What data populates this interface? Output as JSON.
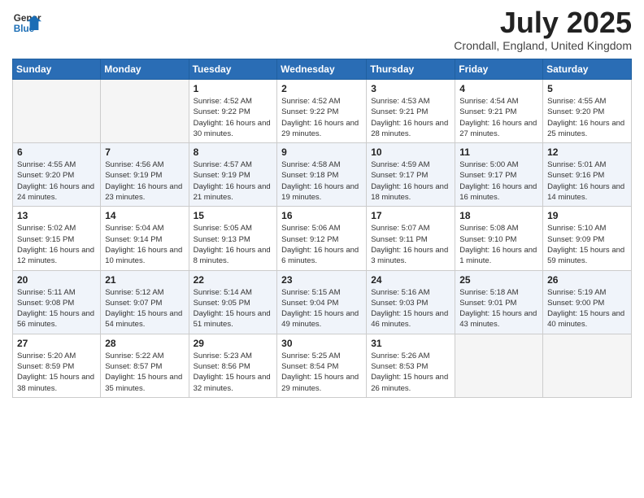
{
  "header": {
    "logo_general": "General",
    "logo_blue": "Blue",
    "month_title": "July 2025",
    "location": "Crondall, England, United Kingdom"
  },
  "weekdays": [
    "Sunday",
    "Monday",
    "Tuesday",
    "Wednesday",
    "Thursday",
    "Friday",
    "Saturday"
  ],
  "weeks": [
    [
      {
        "day": "",
        "empty": true
      },
      {
        "day": "",
        "empty": true
      },
      {
        "day": "1",
        "sunrise": "4:52 AM",
        "sunset": "9:22 PM",
        "daylight": "16 hours and 30 minutes."
      },
      {
        "day": "2",
        "sunrise": "4:52 AM",
        "sunset": "9:22 PM",
        "daylight": "16 hours and 29 minutes."
      },
      {
        "day": "3",
        "sunrise": "4:53 AM",
        "sunset": "9:21 PM",
        "daylight": "16 hours and 28 minutes."
      },
      {
        "day": "4",
        "sunrise": "4:54 AM",
        "sunset": "9:21 PM",
        "daylight": "16 hours and 27 minutes."
      },
      {
        "day": "5",
        "sunrise": "4:55 AM",
        "sunset": "9:20 PM",
        "daylight": "16 hours and 25 minutes."
      }
    ],
    [
      {
        "day": "6",
        "sunrise": "4:55 AM",
        "sunset": "9:20 PM",
        "daylight": "16 hours and 24 minutes."
      },
      {
        "day": "7",
        "sunrise": "4:56 AM",
        "sunset": "9:19 PM",
        "daylight": "16 hours and 23 minutes."
      },
      {
        "day": "8",
        "sunrise": "4:57 AM",
        "sunset": "9:19 PM",
        "daylight": "16 hours and 21 minutes."
      },
      {
        "day": "9",
        "sunrise": "4:58 AM",
        "sunset": "9:18 PM",
        "daylight": "16 hours and 19 minutes."
      },
      {
        "day": "10",
        "sunrise": "4:59 AM",
        "sunset": "9:17 PM",
        "daylight": "16 hours and 18 minutes."
      },
      {
        "day": "11",
        "sunrise": "5:00 AM",
        "sunset": "9:17 PM",
        "daylight": "16 hours and 16 minutes."
      },
      {
        "day": "12",
        "sunrise": "5:01 AM",
        "sunset": "9:16 PM",
        "daylight": "16 hours and 14 minutes."
      }
    ],
    [
      {
        "day": "13",
        "sunrise": "5:02 AM",
        "sunset": "9:15 PM",
        "daylight": "16 hours and 12 minutes."
      },
      {
        "day": "14",
        "sunrise": "5:04 AM",
        "sunset": "9:14 PM",
        "daylight": "16 hours and 10 minutes."
      },
      {
        "day": "15",
        "sunrise": "5:05 AM",
        "sunset": "9:13 PM",
        "daylight": "16 hours and 8 minutes."
      },
      {
        "day": "16",
        "sunrise": "5:06 AM",
        "sunset": "9:12 PM",
        "daylight": "16 hours and 6 minutes."
      },
      {
        "day": "17",
        "sunrise": "5:07 AM",
        "sunset": "9:11 PM",
        "daylight": "16 hours and 3 minutes."
      },
      {
        "day": "18",
        "sunrise": "5:08 AM",
        "sunset": "9:10 PM",
        "daylight": "16 hours and 1 minute."
      },
      {
        "day": "19",
        "sunrise": "5:10 AM",
        "sunset": "9:09 PM",
        "daylight": "15 hours and 59 minutes."
      }
    ],
    [
      {
        "day": "20",
        "sunrise": "5:11 AM",
        "sunset": "9:08 PM",
        "daylight": "15 hours and 56 minutes."
      },
      {
        "day": "21",
        "sunrise": "5:12 AM",
        "sunset": "9:07 PM",
        "daylight": "15 hours and 54 minutes."
      },
      {
        "day": "22",
        "sunrise": "5:14 AM",
        "sunset": "9:05 PM",
        "daylight": "15 hours and 51 minutes."
      },
      {
        "day": "23",
        "sunrise": "5:15 AM",
        "sunset": "9:04 PM",
        "daylight": "15 hours and 49 minutes."
      },
      {
        "day": "24",
        "sunrise": "5:16 AM",
        "sunset": "9:03 PM",
        "daylight": "15 hours and 46 minutes."
      },
      {
        "day": "25",
        "sunrise": "5:18 AM",
        "sunset": "9:01 PM",
        "daylight": "15 hours and 43 minutes."
      },
      {
        "day": "26",
        "sunrise": "5:19 AM",
        "sunset": "9:00 PM",
        "daylight": "15 hours and 40 minutes."
      }
    ],
    [
      {
        "day": "27",
        "sunrise": "5:20 AM",
        "sunset": "8:59 PM",
        "daylight": "15 hours and 38 minutes."
      },
      {
        "day": "28",
        "sunrise": "5:22 AM",
        "sunset": "8:57 PM",
        "daylight": "15 hours and 35 minutes."
      },
      {
        "day": "29",
        "sunrise": "5:23 AM",
        "sunset": "8:56 PM",
        "daylight": "15 hours and 32 minutes."
      },
      {
        "day": "30",
        "sunrise": "5:25 AM",
        "sunset": "8:54 PM",
        "daylight": "15 hours and 29 minutes."
      },
      {
        "day": "31",
        "sunrise": "5:26 AM",
        "sunset": "8:53 PM",
        "daylight": "15 hours and 26 minutes."
      },
      {
        "day": "",
        "empty": true
      },
      {
        "day": "",
        "empty": true
      }
    ]
  ],
  "labels": {
    "sunrise": "Sunrise:",
    "sunset": "Sunset:",
    "daylight": "Daylight:"
  }
}
